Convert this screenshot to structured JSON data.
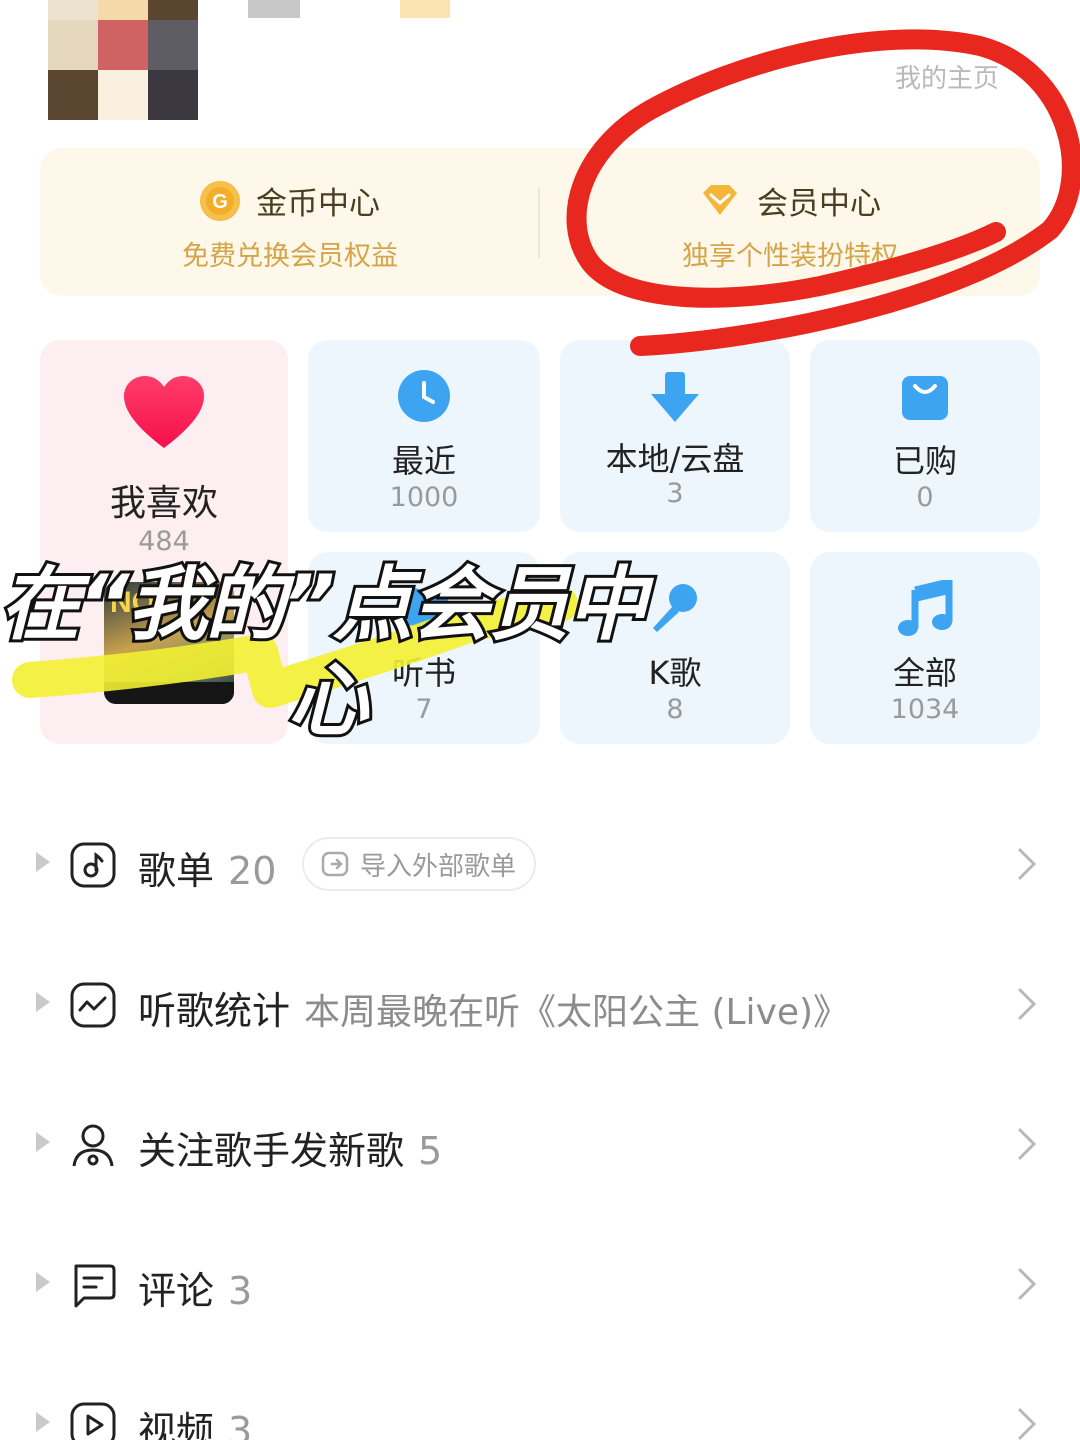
{
  "header": {
    "home_link": "我的主页"
  },
  "promo": {
    "coin": {
      "title": "金币中心",
      "subtitle": "免费兑换会员权益",
      "icon": "coin-g-icon"
    },
    "vip": {
      "title": "会员中心",
      "subtitle": "独享个性装扮特权",
      "icon": "diamond-icon"
    }
  },
  "tiles": [
    {
      "label": "我喜欢",
      "count": "484",
      "icon": "heart-icon"
    },
    {
      "label": "最近",
      "count": "1000",
      "icon": "clock-icon"
    },
    {
      "label": "本地/云盘",
      "count": "3",
      "icon": "download-arrow-icon"
    },
    {
      "label": "已购",
      "count": "0",
      "icon": "shopping-bag-icon"
    },
    {
      "label": "听书",
      "count": "7",
      "icon": "audiobook-icon"
    },
    {
      "label": "K歌",
      "count": "8",
      "icon": "microphone-icon"
    },
    {
      "label": "全部",
      "count": "1034",
      "icon": "music-note-icon"
    }
  ],
  "overlay": {
    "caption_line1": "在“我的”点会员中",
    "caption_line2": "心"
  },
  "list": [
    {
      "title": "歌单",
      "count": "20",
      "button": "导入外部歌单",
      "icon": "playlist-note-icon"
    },
    {
      "title": "听歌统计",
      "subtitle": "本周最晚在听《太阳公主 (Live)》",
      "icon": "stats-chart-icon"
    },
    {
      "title": "关注歌手发新歌",
      "count": "5",
      "icon": "artist-person-icon"
    },
    {
      "title": "评论",
      "count": "3",
      "icon": "comment-icon"
    },
    {
      "title": "视频",
      "count": "3",
      "icon": "video-play-icon"
    }
  ],
  "colors": {
    "accent_blue": "#3da4f2",
    "gold": "#d6a448",
    "annotation_red": "#e8271e",
    "highlight_yellow": "#f3f032"
  }
}
